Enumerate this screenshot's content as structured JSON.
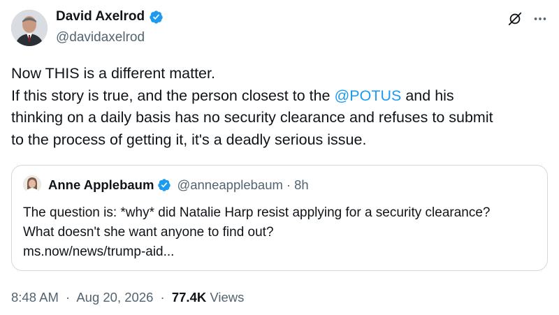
{
  "author": {
    "name": "David Axelrod",
    "handle": "@davidaxelrod"
  },
  "tweet": {
    "line1": "Now THIS is a different matter.",
    "line2_pre": "If this story is true, and the person closest to the ",
    "mention": "@POTUS",
    "line2_post": " and his",
    "line3": "thinking on a daily basis has no security clearance and refuses to submit",
    "line4": "to the process of getting it, it's a deadly serious issue."
  },
  "quote": {
    "name": "Anne Applebaum",
    "handle": "@anneapplebaum",
    "dot": "·",
    "time": "8h",
    "line1": "The question is: *why* did Natalie Harp resist applying for a security clearance?",
    "line2": "What doesn't she want anyone to find out?",
    "line3": "ms.now/news/trump-aid..."
  },
  "meta": {
    "time": "8:48 AM",
    "sep1": "·",
    "date": "Aug 20, 2026",
    "sep2": "·",
    "views_count": "77.4K",
    "views_label": "Views"
  },
  "colors": {
    "accent": "#1d9bf0",
    "text": "#0f1419",
    "secondary": "#536471",
    "border": "#cfd9de"
  },
  "icons": {
    "verified": "verified-badge-icon",
    "grok": "grok-icon",
    "more": "more-options-icon"
  }
}
